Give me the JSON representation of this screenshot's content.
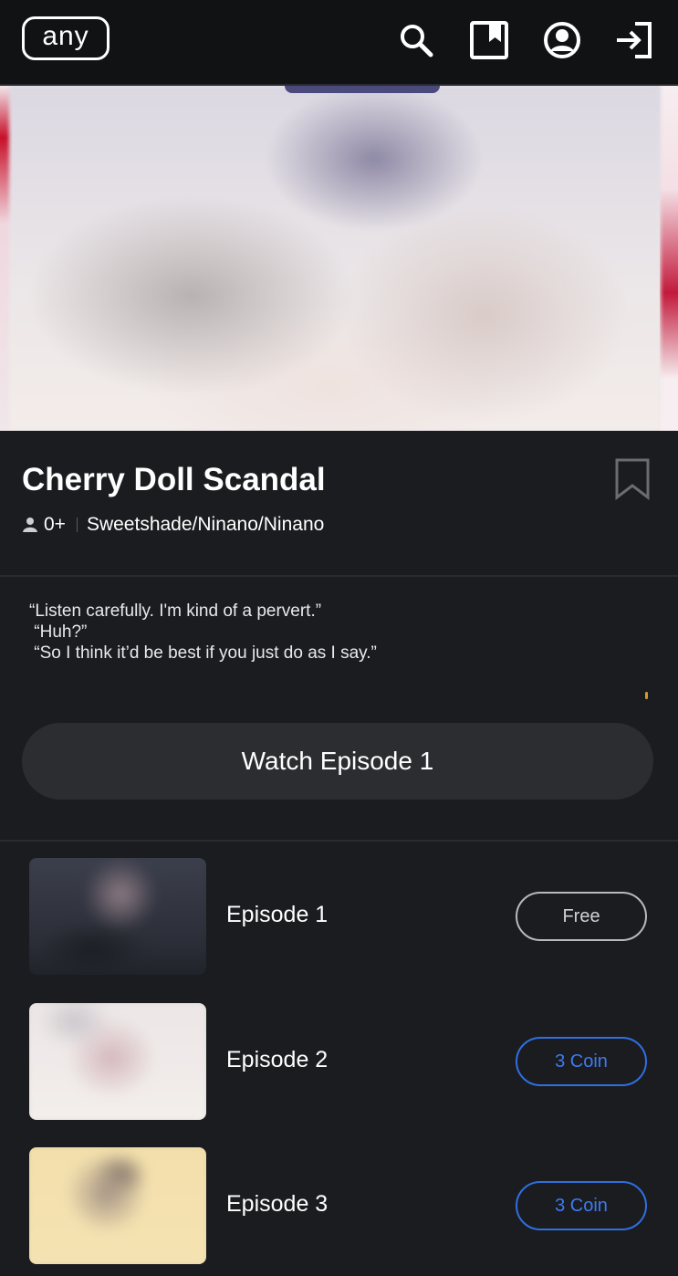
{
  "header": {
    "logo_text": "any",
    "icons": [
      "search-icon",
      "library-icon",
      "account-icon",
      "login-icon"
    ]
  },
  "series": {
    "title": "Cherry Doll Scandal",
    "age_rating": "0+",
    "authors": "Sweetshade/Ninano/Ninano"
  },
  "description": {
    "lines": [
      "“Listen carefully. I'm kind of a pervert.”",
      " “Huh?”",
      " “So I think it’d be best if you just do as I say.”"
    ]
  },
  "watch_button": {
    "label": "Watch Episode 1"
  },
  "episodes": [
    {
      "label": "Episode 1",
      "price": "Free",
      "type": "free"
    },
    {
      "label": "Episode 2",
      "price": "3 Coin",
      "type": "coin"
    },
    {
      "label": "Episode 3",
      "price": "3 Coin",
      "type": "coin"
    }
  ],
  "colors": {
    "background": "#1b1c20",
    "header": "#111214",
    "coin_accent": "#2f6fe0",
    "button_bg": "#2c2d31"
  }
}
